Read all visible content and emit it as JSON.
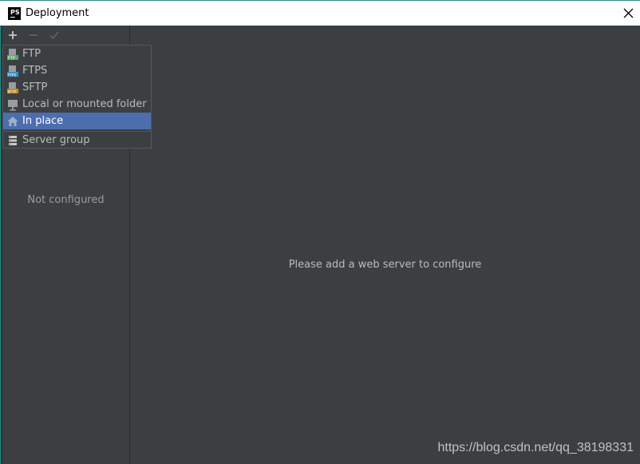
{
  "window": {
    "title": "Deployment",
    "app_icon": "phpstorm-logo",
    "app_icon_text": "PS"
  },
  "toolbar": {
    "add": "plus-icon",
    "remove": "minus-icon",
    "apply": "check-icon"
  },
  "left_panel": {
    "empty_text": "Not configured"
  },
  "right_panel": {
    "empty_text": "Please add a web server to configure"
  },
  "popup_menu": {
    "items": [
      {
        "label": "FTP",
        "icon": "ftp-icon"
      },
      {
        "label": "FTPS",
        "icon": "ftps-icon"
      },
      {
        "label": "SFTP",
        "icon": "sftp-icon"
      },
      {
        "label": "Local or mounted folder",
        "icon": "local-folder-icon"
      },
      {
        "label": "In place",
        "icon": "home-icon",
        "selected": true
      },
      {
        "label": "Server group",
        "icon": "server-group-icon"
      }
    ]
  },
  "watermark": {
    "text": "https://blog.csdn.net/qq_38198331"
  },
  "colors": {
    "panel_bg": "#3c3f41",
    "selection": "#4b6eaf",
    "text": "#bbbbbb"
  }
}
